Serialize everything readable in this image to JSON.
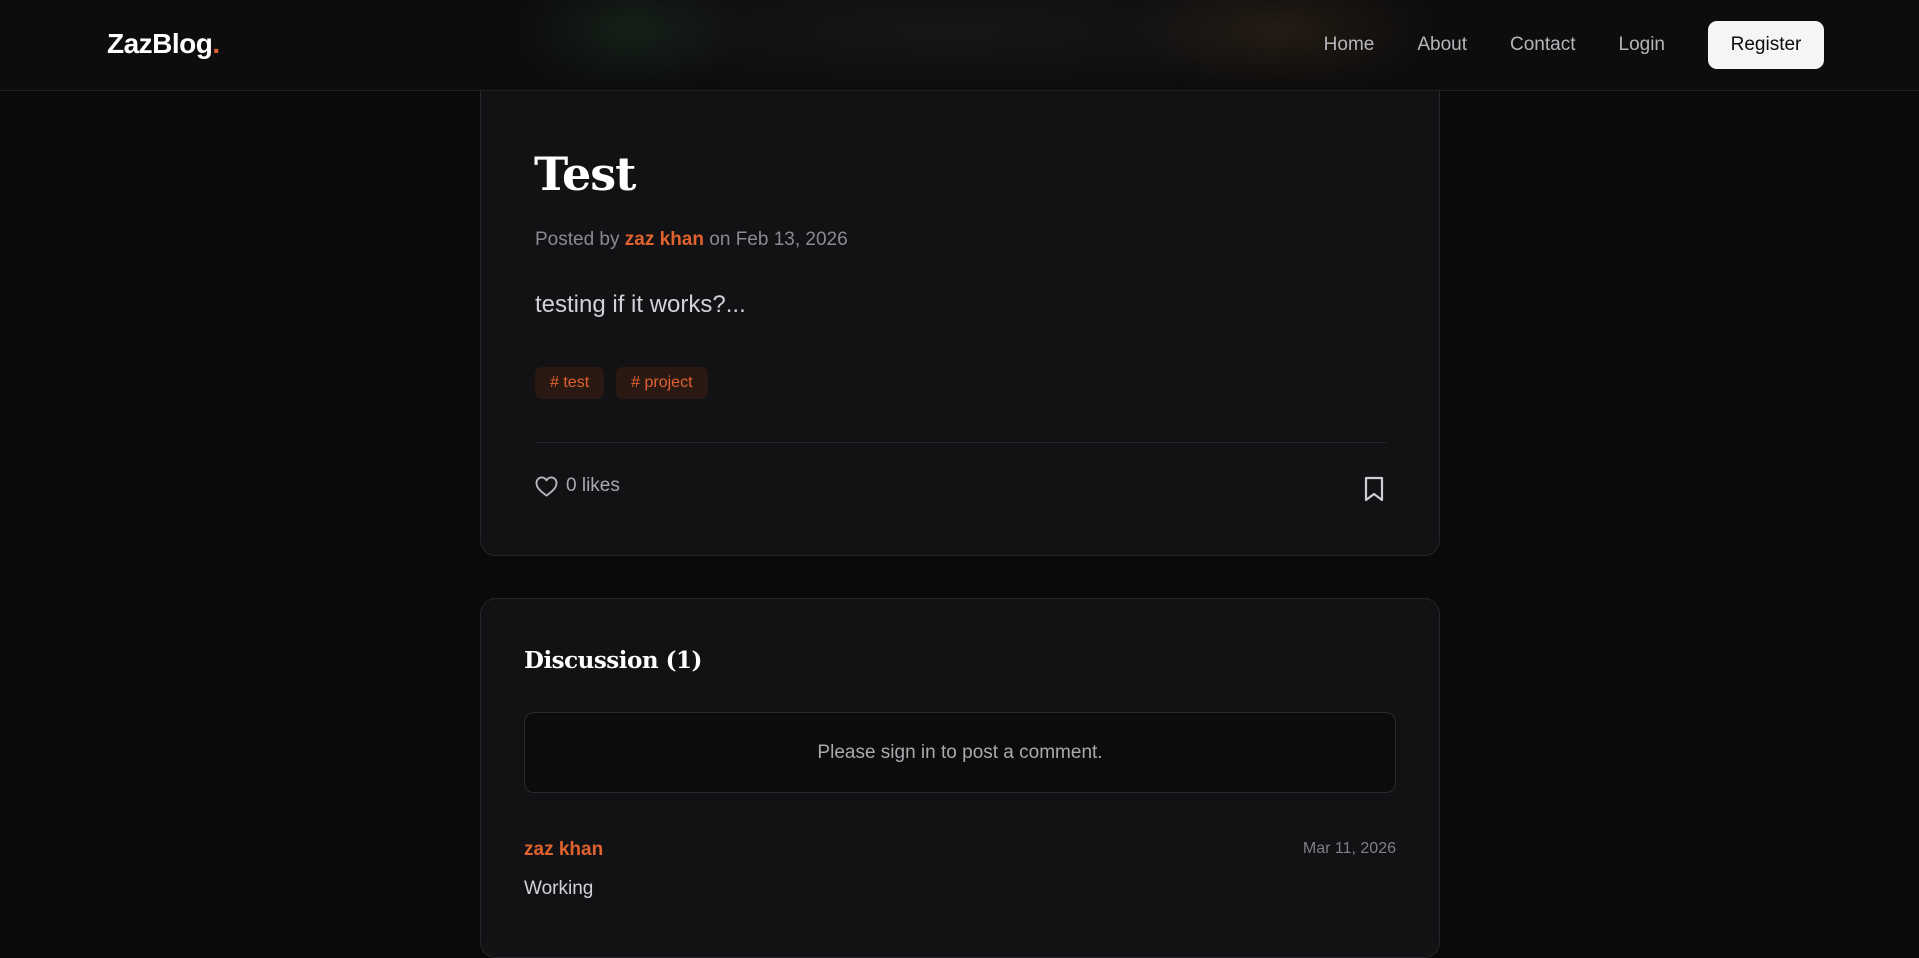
{
  "header": {
    "logo_text": "ZazBlog",
    "logo_dot": ".",
    "nav": [
      {
        "label": "Home"
      },
      {
        "label": "About"
      },
      {
        "label": "Contact"
      },
      {
        "label": "Login"
      }
    ],
    "register_label": "Register"
  },
  "post": {
    "title": "Test",
    "meta_prefix": "Posted by",
    "author": "zaz khan",
    "meta_on": "on",
    "date": "Feb 13, 2026",
    "body": "testing if it works?...",
    "tags": [
      {
        "label": "# test"
      },
      {
        "label": "# project"
      }
    ],
    "likes_label": "0 likes",
    "icons": {
      "like": "heart-icon",
      "save": "bookmark-icon"
    }
  },
  "discussion": {
    "title": "Discussion (1)",
    "signin_prompt": "Please sign in to post a comment.",
    "comments": [
      {
        "author": "zaz khan",
        "date": "Mar 11, 2026",
        "text": "Working"
      }
    ]
  },
  "colors": {
    "accent": "#e0622f",
    "background": "#0a0a0b",
    "card": "#121214"
  }
}
